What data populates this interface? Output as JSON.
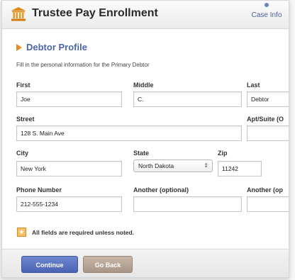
{
  "header": {
    "title": "Trustee Pay Enrollment",
    "case_info_label": "Case Info"
  },
  "section": {
    "title": "Debtor Profile",
    "instructions": "Fill in the personal information for the Primary Debtor"
  },
  "fields": {
    "first": {
      "label": "First",
      "value": "Joe"
    },
    "middle": {
      "label": "Middle",
      "value": "C."
    },
    "last": {
      "label": "Last",
      "value": "Debtor"
    },
    "street": {
      "label": "Street",
      "value": "128 S. Main Ave"
    },
    "apt": {
      "label": "Apt/Suite (O",
      "value": ""
    },
    "city": {
      "label": "City",
      "value": "New York"
    },
    "state": {
      "label": "State",
      "value": "North Dakota"
    },
    "zip": {
      "label": "Zip",
      "value": "11242"
    },
    "phone": {
      "label": "Phone Number",
      "value": "212-555-1234"
    },
    "phone_alt1": {
      "label": "Another (optional)",
      "value": ""
    },
    "phone_alt2": {
      "label": "Another (op",
      "value": ""
    }
  },
  "note": {
    "text": "All fields are required unless noted."
  },
  "buttons": {
    "continue": "Continue",
    "go_back": "Go Back"
  },
  "icons": {
    "header": "bank-icon",
    "case_info": "info-dot-icon",
    "section": "arrow-right-icon",
    "note": "star-icon",
    "select": "chevron-updown-icon"
  },
  "colors": {
    "accent": "#4a66a8",
    "section_arrow": "#e88c1f",
    "note_icon": "#f7c067",
    "continue_button": "#5a74c0",
    "back_button": "#b5a393"
  }
}
